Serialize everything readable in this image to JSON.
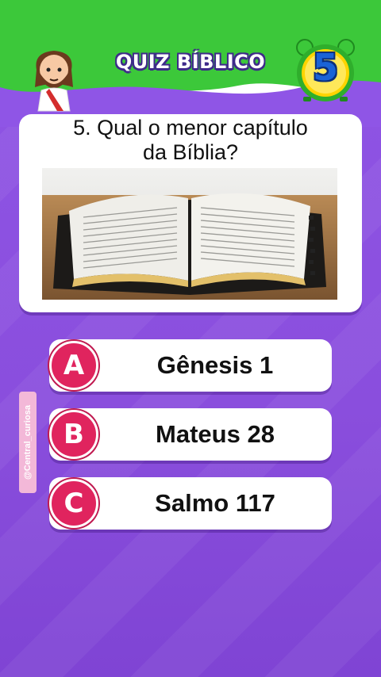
{
  "header": {
    "title": "QUIZ BÍBLICO",
    "counter": "5",
    "mascot_icon": "jesus-cartoon-icon",
    "timer_icon": "alarm-clock-icon"
  },
  "question": {
    "text_line1": "5. Qual o menor capítulo",
    "text_line2": "da Bíblia?",
    "image": "open-bible-photo"
  },
  "options": [
    {
      "letter": "A",
      "text": "Gênesis 1"
    },
    {
      "letter": "B",
      "text": "Mateus 28"
    },
    {
      "letter": "C",
      "text": "Salmo 117"
    }
  ],
  "watermark": "@Central_curiosa",
  "colors": {
    "background": "#8b4fe0",
    "header_green": "#3cc83a",
    "option_circle": "#e0245e",
    "badge_yellow": "#ffd400",
    "badge_number": "#1a63d6"
  }
}
